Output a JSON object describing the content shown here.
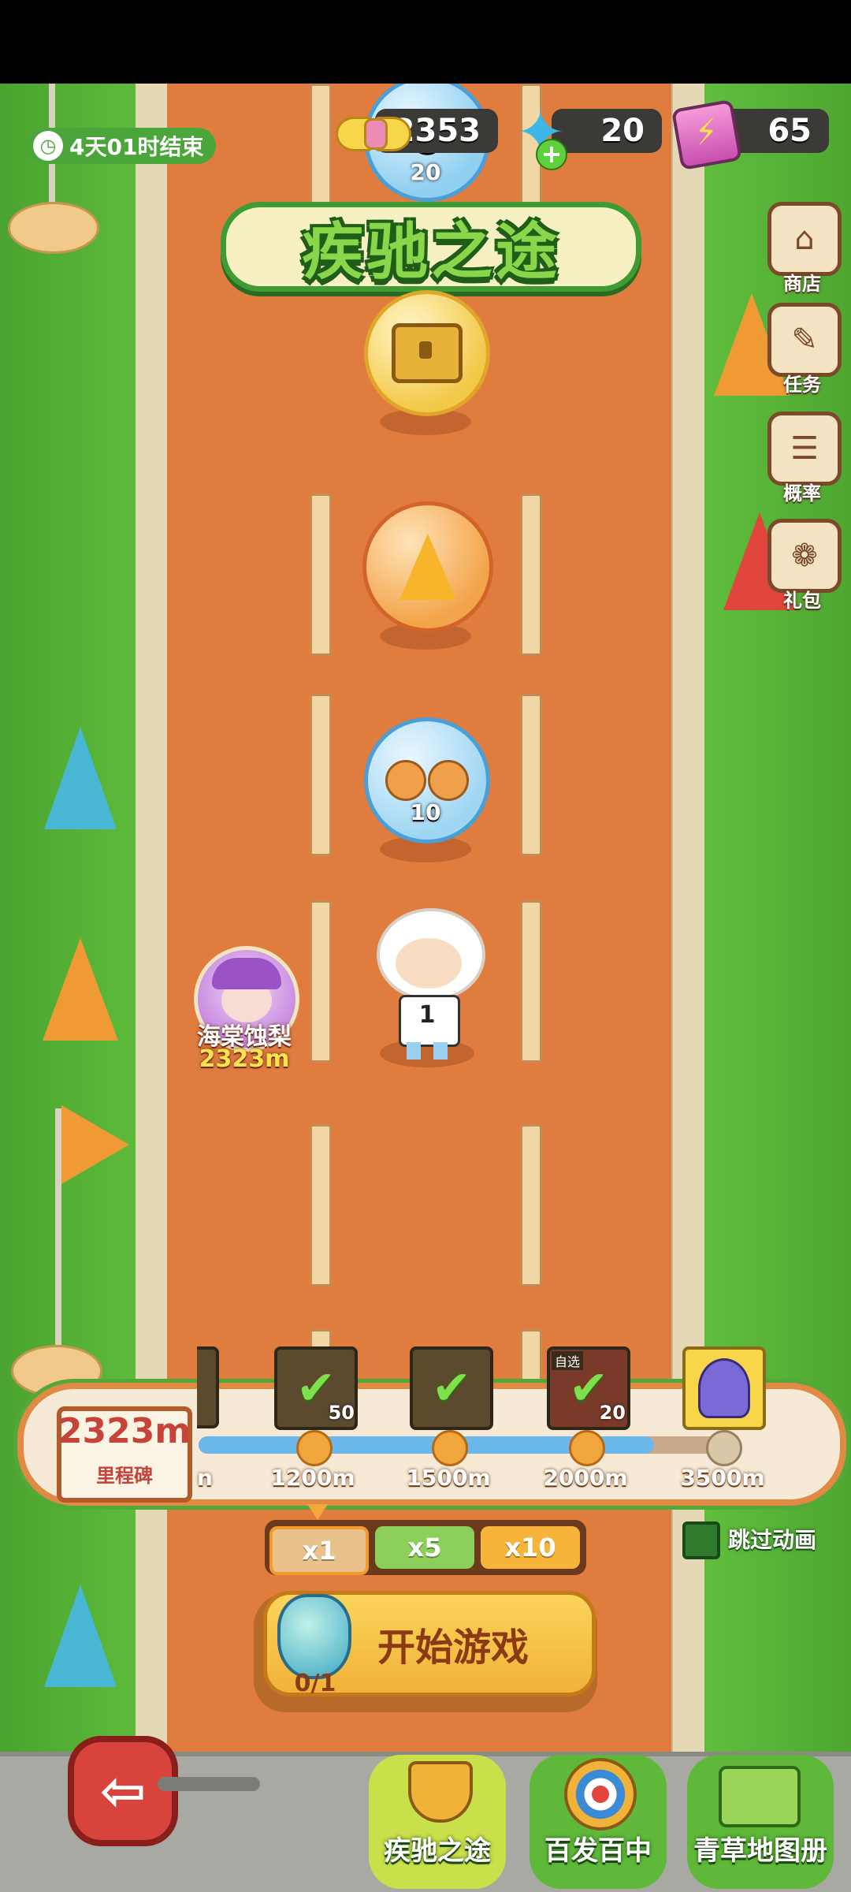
{
  "event": {
    "countdown": "4天01时结束",
    "title": "疾驰之途"
  },
  "currencies": [
    {
      "icon": "gold-bow-icon",
      "value": "2353"
    },
    {
      "icon": "blue-crystal-icon",
      "value": "20"
    },
    {
      "icon": "energy-battery-icon",
      "value": "65"
    }
  ],
  "side_menu": [
    {
      "icon": "shop-icon",
      "label": "商店"
    },
    {
      "icon": "task-icon",
      "label": "任务"
    },
    {
      "icon": "probability-icon",
      "label": "概率"
    },
    {
      "icon": "gift-pack-icon",
      "label": "礼包"
    }
  ],
  "track_items": [
    {
      "icon": "cat-coins-icon",
      "count": "20"
    },
    {
      "icon": "treasure-chest-icon",
      "count": ""
    },
    {
      "icon": "gold-crystal-icon",
      "count": ""
    },
    {
      "icon": "cat-coins-icon",
      "count": "10"
    }
  ],
  "rival": {
    "name": "海棠蚀梨",
    "distance": "2323m"
  },
  "player": {
    "bib": "1"
  },
  "milestone": {
    "distance": "2323m",
    "label": "里程碑",
    "progress_fraction": 0.85,
    "partial_label": "n",
    "nodes": [
      {
        "distance": "1200m",
        "reward_count": "50",
        "claimed": true
      },
      {
        "distance": "1500m",
        "reward_count": "",
        "claimed": true
      },
      {
        "distance": "2000m",
        "reward_count": "20",
        "tag": "自选",
        "claimed": true
      },
      {
        "distance": "3500m",
        "reward_count": "",
        "claimed": false
      }
    ]
  },
  "multipliers": [
    "x1",
    "x5",
    "x10"
  ],
  "skip_animation_label": "跳过动画",
  "start": {
    "label": "开始游戏",
    "ticket": "0/1"
  },
  "bottom_nav": [
    {
      "icon": "trophy-icon",
      "label": "疾驰之途"
    },
    {
      "icon": "target-icon",
      "label": "百发百中"
    },
    {
      "icon": "map-album-icon",
      "label": "青草地图册"
    }
  ],
  "colors": {
    "track": "#df7c3e",
    "grass": "#56b437",
    "accent_yellow": "#f7c646",
    "dark_pill": "#3c3a36"
  }
}
